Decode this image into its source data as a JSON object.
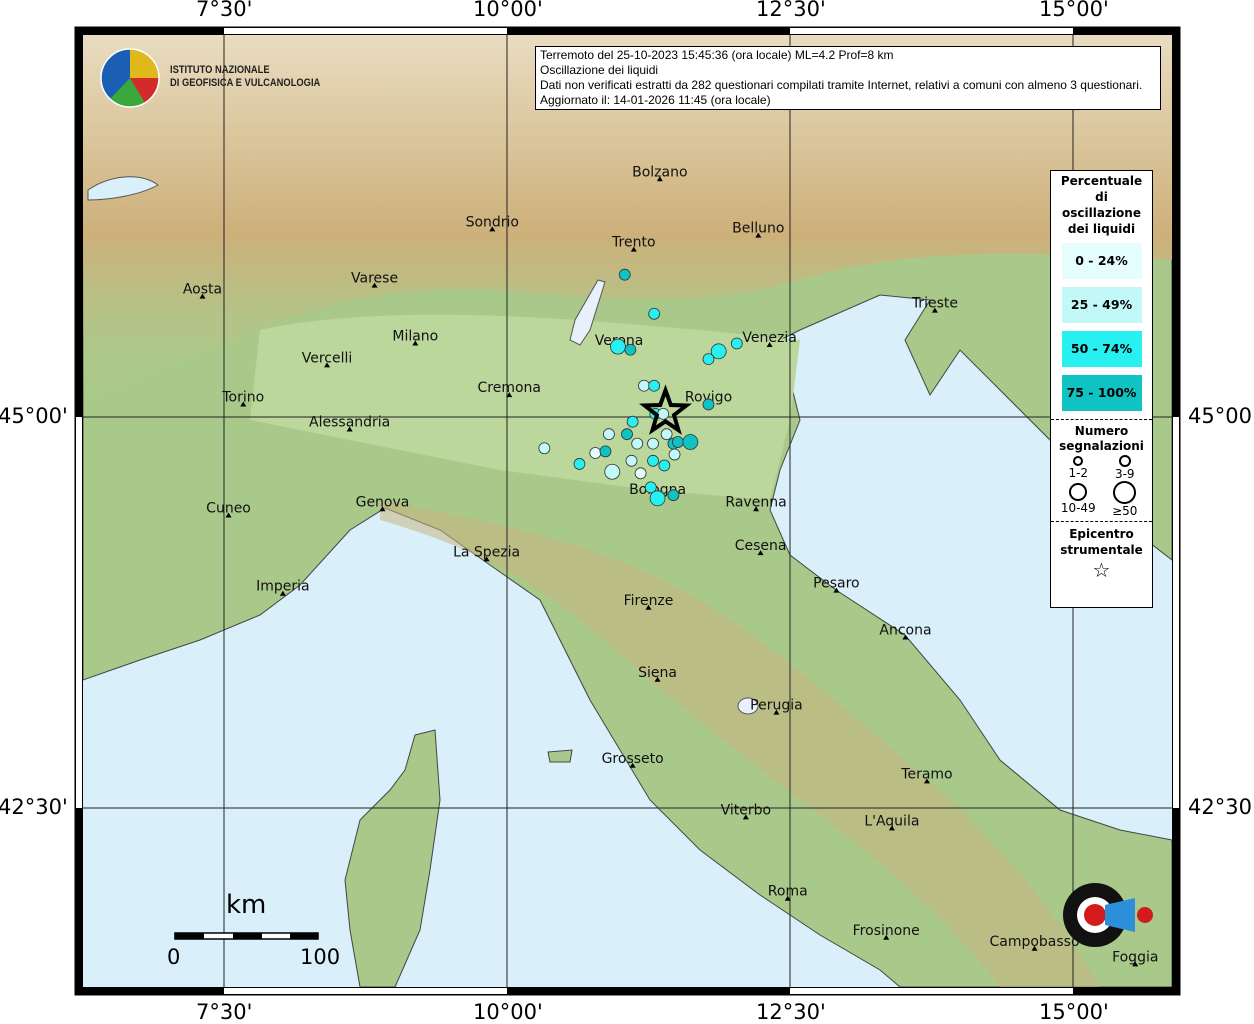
{
  "info_box": {
    "line1": "Terremoto del 25-10-2023 15:45:36 (ora locale) ML=4.2 Prof=8 km",
    "line2": "Oscillazione dei liquidi",
    "line3": "Dati non verificati estratti da 282 questionari compilati tramite Internet, relativi a comuni con almeno 3 questionari.",
    "line4": "Aggiornato il: 14-01-2026 11:45 (ora locale)"
  },
  "logos": {
    "ingv": "ISTITUTO NAZIONALE DI GEOFISICA E VULCANOLOGIA",
    "ingv_line1": "ISTITUTO NAZIONALE",
    "ingv_line2": "DI GEOFISICA E VULCANOLOGIA",
    "hsit": "www.haisentitoilterremoto.it"
  },
  "axes": {
    "lon_labels": [
      "7°30'",
      "10°00'",
      "12°30'",
      "15°00'"
    ],
    "lat_labels": [
      "45°00'",
      "42°30'"
    ],
    "lon_values": [
      7.5,
      10.0,
      12.5,
      15.0
    ],
    "lat_values": [
      45.0,
      42.5
    ]
  },
  "legend": {
    "title": "Percentuale di oscillazione dei liquidi",
    "classes": [
      {
        "label": "0 - 24%",
        "color": "#e6fdfd"
      },
      {
        "label": "25 - 49%",
        "color": "#c2f8f8"
      },
      {
        "label": "50 - 74%",
        "color": "#28f0f0"
      },
      {
        "label": "75 - 100%",
        "color": "#10c3c3"
      }
    ],
    "size_title": "Numero segnalazioni",
    "sizes": [
      "1-2",
      "3-9",
      "10-49",
      "≥50"
    ],
    "epicenter_title": "Epicentro strumentale"
  },
  "scale_bar": {
    "unit": "km",
    "start": "0",
    "end": "100"
  },
  "epicenter": {
    "lon": 11.4,
    "lat": 45.03
  },
  "cities": [
    {
      "name": "Bolzano",
      "lon": 11.35,
      "lat": 46.52
    },
    {
      "name": "Trento",
      "lon": 11.12,
      "lat": 46.07
    },
    {
      "name": "Belluno",
      "lon": 12.22,
      "lat": 46.16
    },
    {
      "name": "Sondrio",
      "lon": 9.87,
      "lat": 46.2
    },
    {
      "name": "Varese",
      "lon": 8.83,
      "lat": 45.84
    },
    {
      "name": "Aosta",
      "lon": 7.31,
      "lat": 45.77
    },
    {
      "name": "Milano",
      "lon": 9.19,
      "lat": 45.47
    },
    {
      "name": "Vercelli",
      "lon": 8.41,
      "lat": 45.33
    },
    {
      "name": "Torino",
      "lon": 7.67,
      "lat": 45.08
    },
    {
      "name": "Alessandria",
      "lon": 8.61,
      "lat": 44.92
    },
    {
      "name": "Cremona",
      "lon": 10.02,
      "lat": 45.14
    },
    {
      "name": "Verona",
      "lon": 10.99,
      "lat": 45.44
    },
    {
      "name": "Venezia",
      "lon": 12.32,
      "lat": 45.46
    },
    {
      "name": "Trieste",
      "lon": 13.78,
      "lat": 45.68
    },
    {
      "name": "Rovigo",
      "lon": 11.78,
      "lat": 45.08
    },
    {
      "name": "Genova",
      "lon": 8.9,
      "lat": 44.41
    },
    {
      "name": "Cuneo",
      "lon": 7.54,
      "lat": 44.37
    },
    {
      "name": "La Spezia",
      "lon": 9.82,
      "lat": 44.09
    },
    {
      "name": "Imperia",
      "lon": 8.02,
      "lat": 43.87
    },
    {
      "name": "Bologna",
      "lon": 11.33,
      "lat": 44.49
    },
    {
      "name": "Ravenna",
      "lon": 12.2,
      "lat": 44.41
    },
    {
      "name": "Cesena",
      "lon": 12.24,
      "lat": 44.13
    },
    {
      "name": "Pesaro",
      "lon": 12.91,
      "lat": 43.89
    },
    {
      "name": "Ancona",
      "lon": 13.52,
      "lat": 43.59
    },
    {
      "name": "Firenze",
      "lon": 11.25,
      "lat": 43.78
    },
    {
      "name": "Siena",
      "lon": 11.33,
      "lat": 43.32
    },
    {
      "name": "Perugia",
      "lon": 12.38,
      "lat": 43.11
    },
    {
      "name": "Grosseto",
      "lon": 11.11,
      "lat": 42.77
    },
    {
      "name": "Teramo",
      "lon": 13.71,
      "lat": 42.67
    },
    {
      "name": "L'Aquila",
      "lon": 13.4,
      "lat": 42.37
    },
    {
      "name": "Viterbo",
      "lon": 12.11,
      "lat": 42.44
    },
    {
      "name": "Roma",
      "lon": 12.48,
      "lat": 41.92
    },
    {
      "name": "Frosinone",
      "lon": 13.35,
      "lat": 41.67
    },
    {
      "name": "Campobasso",
      "lon": 14.66,
      "lat": 41.6
    },
    {
      "name": "Foggia",
      "lon": 15.55,
      "lat": 41.5
    }
  ],
  "observations": [
    {
      "lon": 11.04,
      "lat": 45.91,
      "class": 3,
      "size": 0
    },
    {
      "lon": 11.3,
      "lat": 45.66,
      "class": 2,
      "size": 0
    },
    {
      "lon": 10.98,
      "lat": 45.45,
      "class": 2,
      "size": 1
    },
    {
      "lon": 11.09,
      "lat": 45.43,
      "class": 3,
      "size": 0
    },
    {
      "lon": 12.03,
      "lat": 45.47,
      "class": 2,
      "size": 0
    },
    {
      "lon": 11.87,
      "lat": 45.42,
      "class": 2,
      "size": 1
    },
    {
      "lon": 11.78,
      "lat": 45.37,
      "class": 2,
      "size": 0
    },
    {
      "lon": 11.21,
      "lat": 45.2,
      "class": 1,
      "size": 0
    },
    {
      "lon": 11.3,
      "lat": 45.2,
      "class": 2,
      "size": 0
    },
    {
      "lon": 11.78,
      "lat": 45.08,
      "class": 3,
      "size": 0
    },
    {
      "lon": 11.31,
      "lat": 45.02,
      "class": 2,
      "size": 0
    },
    {
      "lon": 11.38,
      "lat": 45.02,
      "class": 1,
      "size": 0
    },
    {
      "lon": 11.11,
      "lat": 44.97,
      "class": 2,
      "size": 0
    },
    {
      "lon": 10.9,
      "lat": 44.89,
      "class": 1,
      "size": 0
    },
    {
      "lon": 11.06,
      "lat": 44.89,
      "class": 3,
      "size": 0
    },
    {
      "lon": 11.41,
      "lat": 44.89,
      "class": 1,
      "size": 0
    },
    {
      "lon": 11.15,
      "lat": 44.83,
      "class": 1,
      "size": 0
    },
    {
      "lon": 11.29,
      "lat": 44.83,
      "class": 1,
      "size": 0
    },
    {
      "lon": 11.47,
      "lat": 44.83,
      "class": 3,
      "size": 0
    },
    {
      "lon": 11.51,
      "lat": 44.84,
      "class": 3,
      "size": 0
    },
    {
      "lon": 11.62,
      "lat": 44.84,
      "class": 3,
      "size": 1
    },
    {
      "lon": 10.33,
      "lat": 44.8,
      "class": 1,
      "size": 0
    },
    {
      "lon": 11.48,
      "lat": 44.76,
      "class": 1,
      "size": 0
    },
    {
      "lon": 10.78,
      "lat": 44.77,
      "class": 0,
      "size": 0
    },
    {
      "lon": 10.87,
      "lat": 44.78,
      "class": 3,
      "size": 0
    },
    {
      "lon": 10.64,
      "lat": 44.7,
      "class": 2,
      "size": 0
    },
    {
      "lon": 11.1,
      "lat": 44.72,
      "class": 1,
      "size": 0
    },
    {
      "lon": 11.29,
      "lat": 44.72,
      "class": 2,
      "size": 0
    },
    {
      "lon": 11.39,
      "lat": 44.69,
      "class": 2,
      "size": 0
    },
    {
      "lon": 10.93,
      "lat": 44.65,
      "class": 1,
      "size": 1
    },
    {
      "lon": 11.18,
      "lat": 44.64,
      "class": 0,
      "size": 0
    },
    {
      "lon": 11.27,
      "lat": 44.55,
      "class": 2,
      "size": 0
    },
    {
      "lon": 11.33,
      "lat": 44.48,
      "class": 2,
      "size": 1
    },
    {
      "lon": 11.47,
      "lat": 44.5,
      "class": 3,
      "size": 0
    }
  ]
}
